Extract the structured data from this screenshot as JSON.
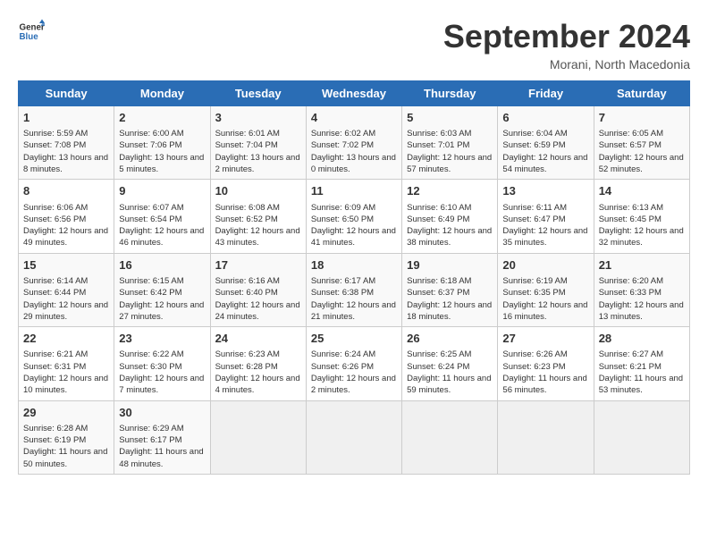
{
  "header": {
    "logo_line1": "General",
    "logo_line2": "Blue",
    "month": "September 2024",
    "location": "Morani, North Macedonia"
  },
  "days_of_week": [
    "Sunday",
    "Monday",
    "Tuesday",
    "Wednesday",
    "Thursday",
    "Friday",
    "Saturday"
  ],
  "weeks": [
    [
      {
        "day": "1",
        "info": "Sunrise: 5:59 AM\nSunset: 7:08 PM\nDaylight: 13 hours and 8 minutes."
      },
      {
        "day": "2",
        "info": "Sunrise: 6:00 AM\nSunset: 7:06 PM\nDaylight: 13 hours and 5 minutes."
      },
      {
        "day": "3",
        "info": "Sunrise: 6:01 AM\nSunset: 7:04 PM\nDaylight: 13 hours and 2 minutes."
      },
      {
        "day": "4",
        "info": "Sunrise: 6:02 AM\nSunset: 7:02 PM\nDaylight: 13 hours and 0 minutes."
      },
      {
        "day": "5",
        "info": "Sunrise: 6:03 AM\nSunset: 7:01 PM\nDaylight: 12 hours and 57 minutes."
      },
      {
        "day": "6",
        "info": "Sunrise: 6:04 AM\nSunset: 6:59 PM\nDaylight: 12 hours and 54 minutes."
      },
      {
        "day": "7",
        "info": "Sunrise: 6:05 AM\nSunset: 6:57 PM\nDaylight: 12 hours and 52 minutes."
      }
    ],
    [
      {
        "day": "8",
        "info": "Sunrise: 6:06 AM\nSunset: 6:56 PM\nDaylight: 12 hours and 49 minutes."
      },
      {
        "day": "9",
        "info": "Sunrise: 6:07 AM\nSunset: 6:54 PM\nDaylight: 12 hours and 46 minutes."
      },
      {
        "day": "10",
        "info": "Sunrise: 6:08 AM\nSunset: 6:52 PM\nDaylight: 12 hours and 43 minutes."
      },
      {
        "day": "11",
        "info": "Sunrise: 6:09 AM\nSunset: 6:50 PM\nDaylight: 12 hours and 41 minutes."
      },
      {
        "day": "12",
        "info": "Sunrise: 6:10 AM\nSunset: 6:49 PM\nDaylight: 12 hours and 38 minutes."
      },
      {
        "day": "13",
        "info": "Sunrise: 6:11 AM\nSunset: 6:47 PM\nDaylight: 12 hours and 35 minutes."
      },
      {
        "day": "14",
        "info": "Sunrise: 6:13 AM\nSunset: 6:45 PM\nDaylight: 12 hours and 32 minutes."
      }
    ],
    [
      {
        "day": "15",
        "info": "Sunrise: 6:14 AM\nSunset: 6:44 PM\nDaylight: 12 hours and 29 minutes."
      },
      {
        "day": "16",
        "info": "Sunrise: 6:15 AM\nSunset: 6:42 PM\nDaylight: 12 hours and 27 minutes."
      },
      {
        "day": "17",
        "info": "Sunrise: 6:16 AM\nSunset: 6:40 PM\nDaylight: 12 hours and 24 minutes."
      },
      {
        "day": "18",
        "info": "Sunrise: 6:17 AM\nSunset: 6:38 PM\nDaylight: 12 hours and 21 minutes."
      },
      {
        "day": "19",
        "info": "Sunrise: 6:18 AM\nSunset: 6:37 PM\nDaylight: 12 hours and 18 minutes."
      },
      {
        "day": "20",
        "info": "Sunrise: 6:19 AM\nSunset: 6:35 PM\nDaylight: 12 hours and 16 minutes."
      },
      {
        "day": "21",
        "info": "Sunrise: 6:20 AM\nSunset: 6:33 PM\nDaylight: 12 hours and 13 minutes."
      }
    ],
    [
      {
        "day": "22",
        "info": "Sunrise: 6:21 AM\nSunset: 6:31 PM\nDaylight: 12 hours and 10 minutes."
      },
      {
        "day": "23",
        "info": "Sunrise: 6:22 AM\nSunset: 6:30 PM\nDaylight: 12 hours and 7 minutes."
      },
      {
        "day": "24",
        "info": "Sunrise: 6:23 AM\nSunset: 6:28 PM\nDaylight: 12 hours and 4 minutes."
      },
      {
        "day": "25",
        "info": "Sunrise: 6:24 AM\nSunset: 6:26 PM\nDaylight: 12 hours and 2 minutes."
      },
      {
        "day": "26",
        "info": "Sunrise: 6:25 AM\nSunset: 6:24 PM\nDaylight: 11 hours and 59 minutes."
      },
      {
        "day": "27",
        "info": "Sunrise: 6:26 AM\nSunset: 6:23 PM\nDaylight: 11 hours and 56 minutes."
      },
      {
        "day": "28",
        "info": "Sunrise: 6:27 AM\nSunset: 6:21 PM\nDaylight: 11 hours and 53 minutes."
      }
    ],
    [
      {
        "day": "29",
        "info": "Sunrise: 6:28 AM\nSunset: 6:19 PM\nDaylight: 11 hours and 50 minutes."
      },
      {
        "day": "30",
        "info": "Sunrise: 6:29 AM\nSunset: 6:17 PM\nDaylight: 11 hours and 48 minutes."
      },
      {
        "day": "",
        "info": ""
      },
      {
        "day": "",
        "info": ""
      },
      {
        "day": "",
        "info": ""
      },
      {
        "day": "",
        "info": ""
      },
      {
        "day": "",
        "info": ""
      }
    ]
  ]
}
